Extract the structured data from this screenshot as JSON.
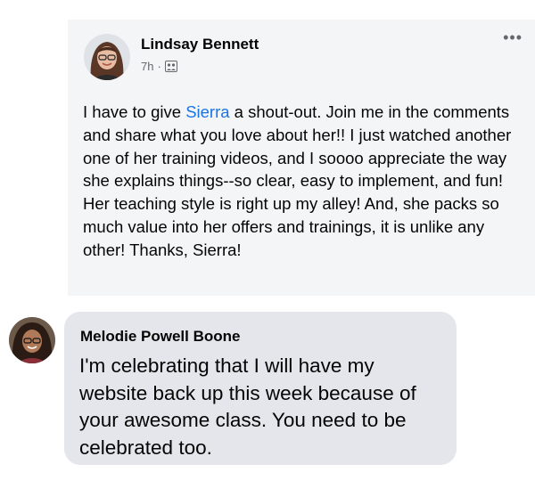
{
  "post": {
    "author": "Lindsay Bennett",
    "time": "7h",
    "separator": "·",
    "more_label": "•••",
    "text_before": "I have to give ",
    "mention": "Sierra",
    "text_after": " a shout-out. Join me in the comments and share what you love about her!! I just watched another one of her training videos, and I soooo appreciate the way she explains things--so clear, easy to implement, and fun! Her teaching style is right up my alley! And, she packs so much value into her offers and trainings, it is unlike any other! Thanks, Sierra!",
    "audience_icon": "group-icon"
  },
  "comment": {
    "author": "Melodie Powell Boone",
    "text": "I'm celebrating that I will have my website back up this week because of your awesome class. You need to be celebrated too."
  }
}
